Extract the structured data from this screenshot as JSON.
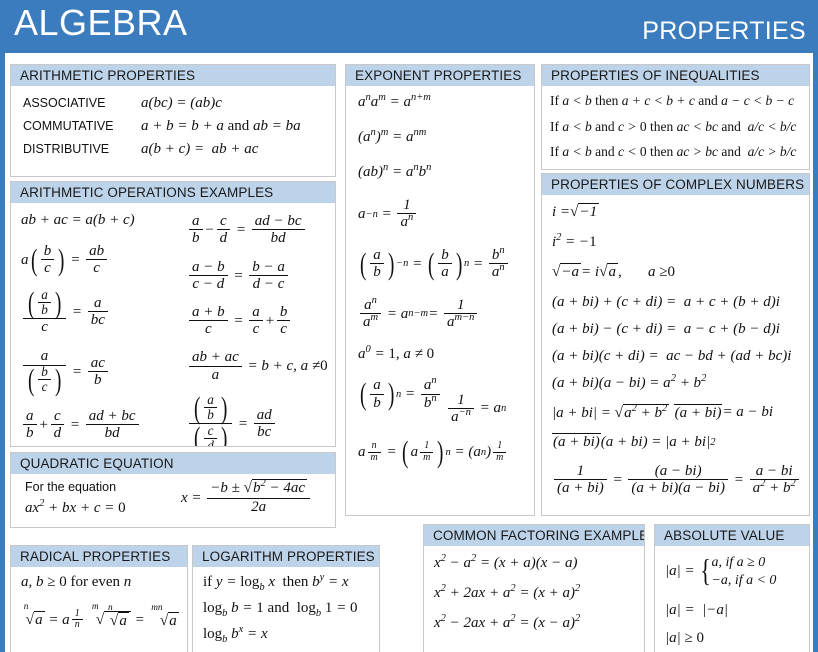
{
  "header": {
    "title": "ALGEBRA",
    "subtitle": "PROPERTIES",
    "bar_color": "#3B7CBF",
    "panel_header_color": "#BDD3E9"
  },
  "panels": {
    "arithmetic_properties": {
      "title": "ARITHMETIC PROPERTIES",
      "rows": [
        {
          "label": "ASSOCIATIVE",
          "formula": "a(bc) = (ab)c"
        },
        {
          "label": "COMMUTATIVE",
          "formula": "a + b = b + a and ab = ba"
        },
        {
          "label": "DISTRIBUTIVE",
          "formula": "a(b + c) = ab + ac"
        }
      ]
    },
    "arithmetic_operations_examples": {
      "title": "ARITHMETIC OPERATIONS EXAMPLES",
      "left_column": [
        "ab + ac = a(b + c)",
        "a(b/c) = ab/c",
        "(a/b)/c = a/bc",
        "a/(b/c) = ac/b",
        "a/b + c/d = (ad + bc)/bd"
      ],
      "right_column": [
        "a/b - c/d = (ad - bc)/bd",
        "(a - b)/(c - d) = (b - a)/(d - c)",
        "(a + b)/c = a/c + b/c",
        "(ab + ac)/a = b + c, a != 0",
        "(a/b)/(c/d) = ad/bc"
      ]
    },
    "quadratic_equation": {
      "title": "QUADRATIC EQUATION",
      "line1": "For the equation",
      "line2": "ax² + bx + c = 0",
      "formula": "x = (-b ± √(b² - 4ac)) / 2a"
    },
    "radical_properties": {
      "title": "RADICAL PROPERTIES",
      "lines": [
        "a, b ≥ 0 for even n",
        "ⁿ√a = a^(1/n)",
        "ᵐ√(ⁿ√a) = ᵐⁿ√a"
      ]
    },
    "logarithm_properties": {
      "title": "LOGARITHM PROPERTIES",
      "lines": [
        "if y = log_b x then b^y = x",
        "log_b b = 1 and log_b 1 = 0",
        "log_b b^x = x"
      ]
    },
    "exponent_properties": {
      "title": "EXPONENT PROPERTIES",
      "lines": [
        "aⁿaᵐ = a^(n+m)",
        "(aⁿ)ᵐ = a^(nm)",
        "(ab)ⁿ = aⁿbⁿ",
        "a^(-n) = 1/aⁿ",
        "(a/b)^(-n) = (b/a)ⁿ = bⁿ/aⁿ",
        "aⁿ/aᵐ = a^(n-m) = 1/a^(m-n)",
        "a⁰ = 1, a ≠ 0",
        "(a/b)ⁿ = aⁿ/bⁿ",
        "1/a^(-n) = aⁿ",
        "a^(n/m) = (a^(1/m))ⁿ = (aⁿ)^(1/m)"
      ]
    },
    "properties_of_inequalities": {
      "title": "PROPERTIES OF INEQUALITIES",
      "lines": [
        "If a < b then a + c < b + c and a - c < b - c",
        "If a < b and c > 0 then ac < bc and a/c < b/c",
        "If a < b and c < 0 then ac > bc and a/c > b/c"
      ]
    },
    "properties_of_complex_numbers": {
      "title": "PROPERTIES OF COMPLEX NUMBERS",
      "lines": [
        "i = √-1",
        "i² = -1",
        "√-a = i√a,    a ≥ 0",
        "(a + bi) + (c + di) = a + c + (b + d)i",
        "(a + bi) - (c + di) = a - c + (b - d)i",
        "(a + bi)(c + di) = ac - bd + (ad + bc)i",
        "(a + bi)(a - bi) = a² + b²",
        "|a + bi| = √(a² + b²)",
        "conj(a + bi) = a - bi",
        "conj(a + bi)(a + bi) = |a + bi|²",
        "1/(a + bi) = (a - bi)/((a + bi)(a - bi)) = (a - bi)/(a² + b²)"
      ]
    },
    "common_factoring_examples": {
      "title": "COMMON FACTORING EXAMPLES",
      "lines": [
        "x² - a² = (x + a)(x - a)",
        "x² + 2ax + a² = (x + a)²",
        "x² - 2ax + a² = (x - a)²"
      ]
    },
    "absolute_value": {
      "title": "ABSOLUTE VALUE",
      "case_line_1": "a,  if a ≥ 0",
      "case_line_2": "−a, if a < 0",
      "lines": [
        "|a| = |-a|",
        "|a| ≥ 0"
      ]
    }
  }
}
